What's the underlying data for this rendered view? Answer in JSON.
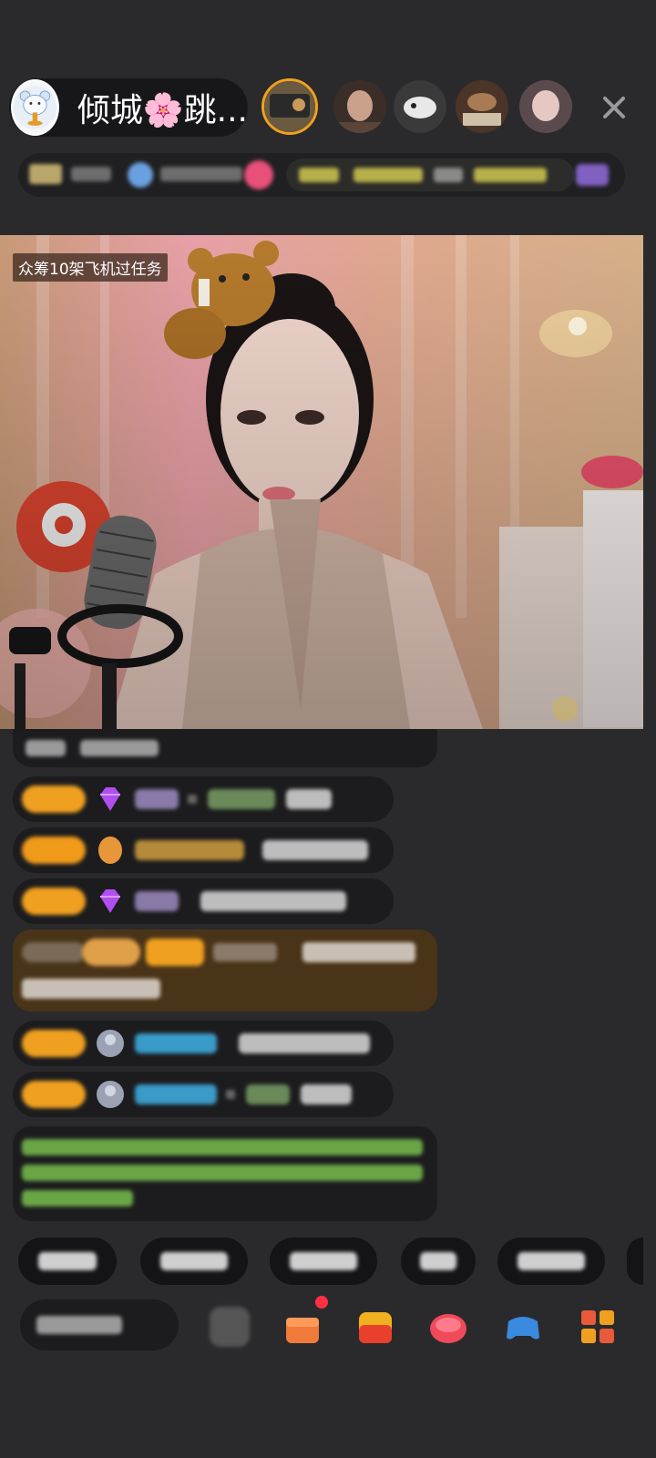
{
  "header": {
    "host_name": "倾城🌸跳...",
    "close_icon": "close-icon"
  },
  "video": {
    "mission_banner": "众筹10架飞机过任务"
  },
  "colors": {
    "background": "#2a2a2c",
    "level_badge": "#f0a020",
    "chat_bubble": "#1c1c1e",
    "highlight_bubble": "#4a3418",
    "announcement_green": "#7ec850"
  }
}
